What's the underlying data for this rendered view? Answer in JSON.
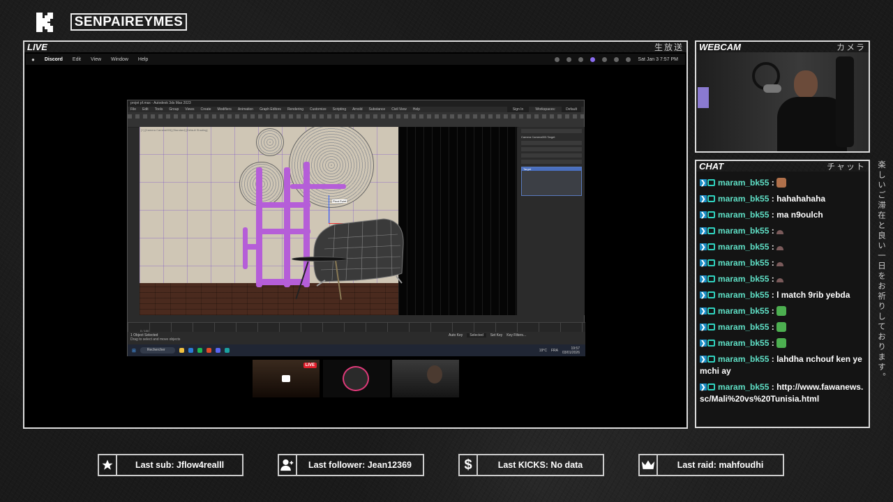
{
  "brand": {
    "name": "SENPAIREYMES",
    "logo_icon": "kick-k-logo-icon"
  },
  "live_panel": {
    "label": "LIVE",
    "jp_label": "生放送"
  },
  "webcam_panel": {
    "label": "WEBCAM",
    "jp_label": "カメラ"
  },
  "chat_panel": {
    "label": "CHAT",
    "jp_label": "チャット"
  },
  "side_text": "楽しいご滞在と良い一日をお祈りしております。",
  "mac_menubar": {
    "app": "Discord",
    "items": [
      "Edit",
      "View",
      "Window",
      "Help"
    ],
    "datetime": "Sat Jan 3  7:57 PM"
  },
  "max_window": {
    "title": "projet pf.max - Autodesk 3ds Max 2023",
    "menus": [
      "File",
      "Edit",
      "Tools",
      "Group",
      "Views",
      "Create",
      "Modifiers",
      "Animation",
      "Graph Editors",
      "Rendering",
      "Customize",
      "Scripting",
      "Arnold",
      "Substance",
      "Civil View",
      "Help"
    ],
    "sign_in": "Sign In",
    "workspaces": "Workspaces:",
    "workspace_value": "Default",
    "viewport_label": "[+] [Camera Camera003] [Standard] [Default Shading]",
    "gizmo_label": "Pivot Point",
    "panel_title": "Camera Camera003.Target",
    "panel_list_item": "Target",
    "frame": "0 / 100",
    "status_left": "1 Object Selected",
    "status_hint": "Drag to select and move objects",
    "auto_key": "Auto Key",
    "selected": "Selected",
    "set_key": "Set Key",
    "key_filters": "Key Filters...",
    "taskbar_search": "Rechercher",
    "weather": "19°C",
    "clock": "19:57",
    "date": "03/01/2026",
    "lang": "FRA"
  },
  "thumbs": {
    "live_badge": "LIVE"
  },
  "chat": {
    "messages": [
      {
        "user": "maram_bk55",
        "text": "",
        "emote": "face-emote"
      },
      {
        "user": "maram_bk55",
        "text": "hahahahaha"
      },
      {
        "user": "maram_bk55",
        "text": "ma n9oulch"
      },
      {
        "user": "maram_bk55",
        "text": "",
        "emote": "small-emote"
      },
      {
        "user": "maram_bk55",
        "text": "",
        "emote": "small-emote"
      },
      {
        "user": "maram_bk55",
        "text": "",
        "emote": "small-emote"
      },
      {
        "user": "maram_bk55",
        "text": "",
        "emote": "small-emote"
      },
      {
        "user": "maram_bk55",
        "text": "l match 9rib yebda"
      },
      {
        "user": "maram_bk55",
        "text": "",
        "emote": "pepe-emote"
      },
      {
        "user": "maram_bk55",
        "text": "",
        "emote": "pepe-emote"
      },
      {
        "user": "maram_bk55",
        "text": "",
        "emote": "pepe-emote"
      },
      {
        "user": "maram_bk55",
        "text": "lahdha nchouf ken yemchi ay"
      },
      {
        "user": "maram_bk55",
        "text": "http://www.fawanews.sc/Mali%20vs%20Tunisia.html"
      }
    ]
  },
  "stats": {
    "last_sub": "Last sub: Jflow4realll",
    "last_follower": "Last follower: Jean12369",
    "last_kicks": "Last KICKS: No data",
    "last_raid": "Last raid: mahfoudhi"
  },
  "colors": {
    "accent": "#5fe0c6",
    "badge_blue": "#1e90c8",
    "live_red": "#e0202c",
    "rack_purple": "#b55ed8"
  }
}
